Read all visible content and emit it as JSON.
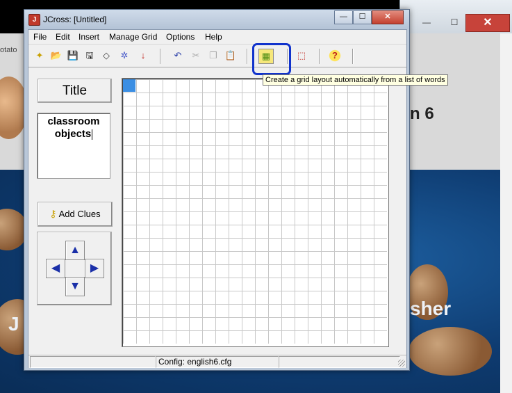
{
  "window": {
    "title": "JCross: [Untitled]",
    "app_icon_glyph": "J"
  },
  "menu": [
    "File",
    "Edit",
    "Insert",
    "Manage Grid",
    "Options",
    "Help"
  ],
  "toolbar": {
    "buttons": [
      {
        "name": "new-icon",
        "glyph": "✦"
      },
      {
        "name": "open-icon",
        "glyph": "📂"
      },
      {
        "name": "save-icon",
        "glyph": "💾"
      },
      {
        "name": "save-as-icon",
        "glyph": "🖫"
      },
      {
        "name": "eraser-icon",
        "glyph": "◇"
      },
      {
        "name": "web-page-icon",
        "glyph": "✲"
      },
      {
        "name": "export-arrow-icon",
        "glyph": "↓"
      },
      {
        "name": "undo-icon",
        "glyph": "↶"
      },
      {
        "name": "cut-icon",
        "glyph": "✂"
      },
      {
        "name": "copy-icon",
        "glyph": "❐"
      },
      {
        "name": "paste-icon",
        "glyph": "📋"
      },
      {
        "name": "auto-grid-icon",
        "glyph": "▦"
      },
      {
        "name": "hot-potatoes-icon",
        "glyph": "⬚"
      },
      {
        "name": "help-icon",
        "glyph": "?"
      }
    ],
    "tooltip": "Create a grid layout automatically from a list of words"
  },
  "left_panel": {
    "title_button": "Title",
    "title_line1": "classroom",
    "title_line2": "objects",
    "add_clues_button": "Add Clues",
    "arrows": {
      "up": "▲",
      "left": "◀",
      "right": "▶",
      "down": "▼"
    }
  },
  "status": {
    "config": "Config: english6.cfg"
  },
  "background": {
    "outer_minimize": "—",
    "outer_maximize": "☐",
    "outer_close": "✕",
    "left_text": "otato",
    "fade_text": "n 6",
    "sher_text": "sher",
    "j_text": "J"
  }
}
